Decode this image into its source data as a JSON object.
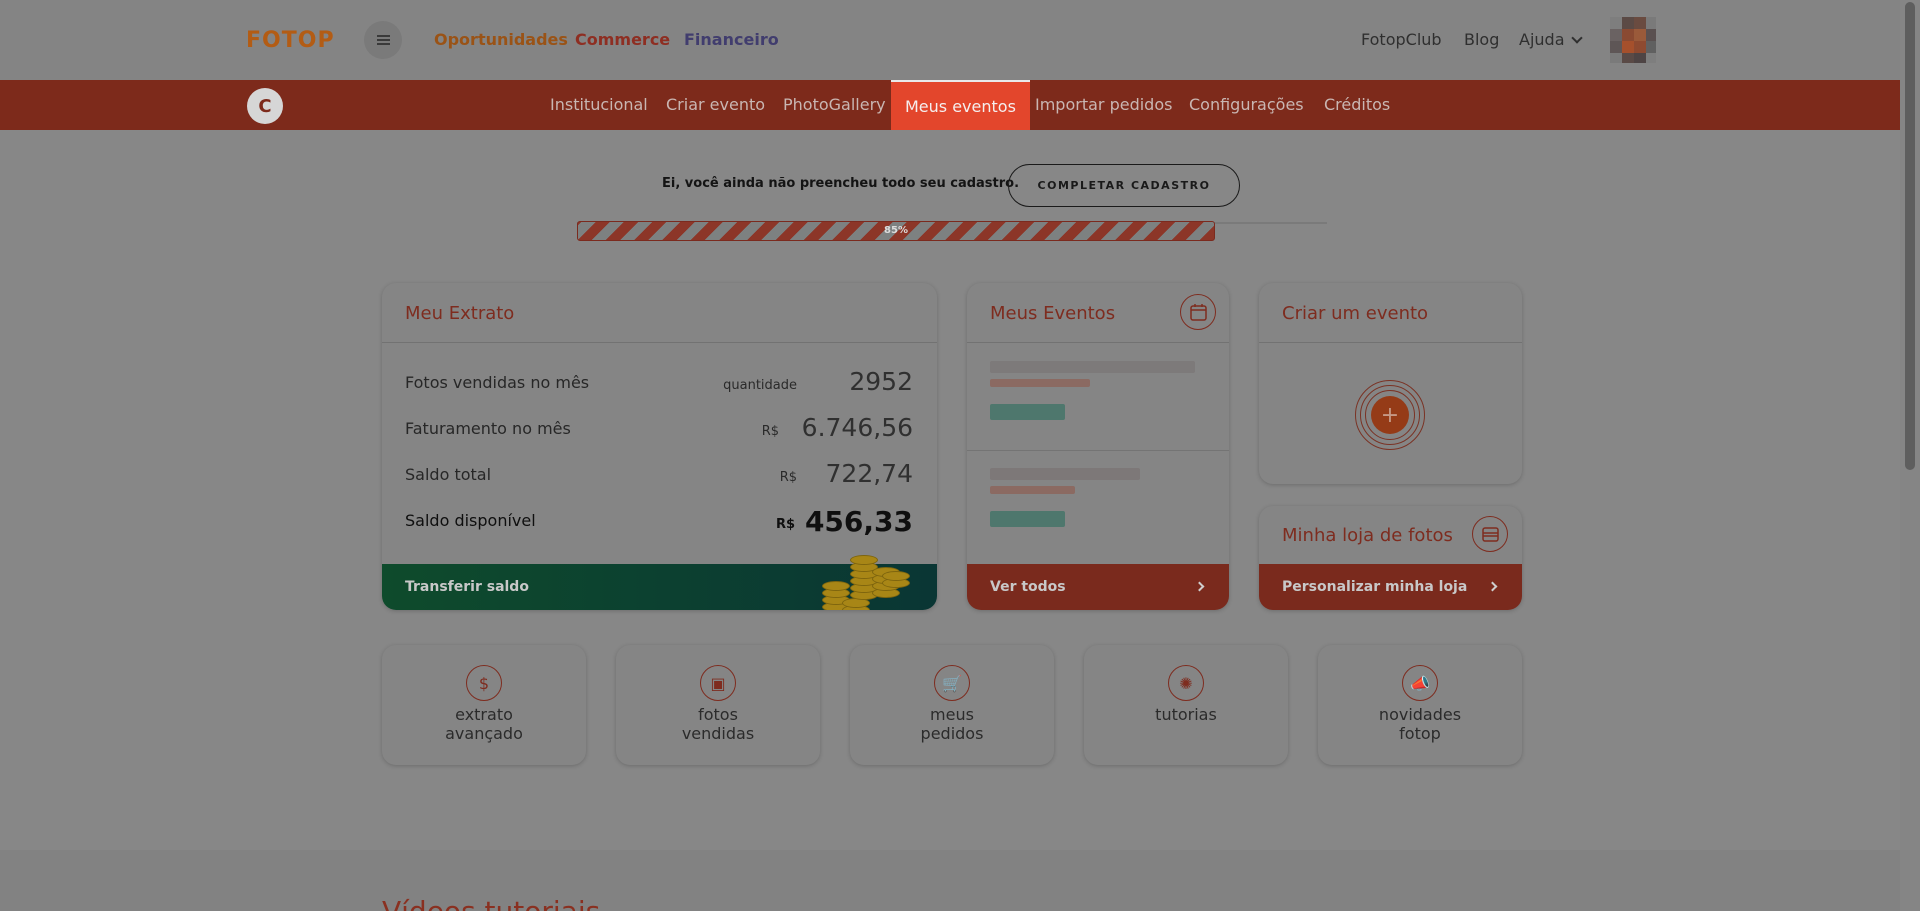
{
  "header": {
    "logo": "FOTOP",
    "links": [
      "Oportunidades",
      "Commerce",
      "Financeiro"
    ],
    "right_links": [
      "FotopClub",
      "Blog",
      "Ajuda"
    ]
  },
  "subnav": {
    "avatar_letter": "C",
    "items": [
      "Institucional",
      "Criar evento",
      "PhotoGallery",
      "Meus eventos",
      "Importar pedidos",
      "Configurações",
      "Créditos"
    ],
    "active": "Meus eventos"
  },
  "registration": {
    "message": "Ei, você ainda não preencheu todo seu cadastro.",
    "button": "COMPLETAR CADASTRO",
    "progress_label": "85%",
    "progress": 0.85
  },
  "extrato": {
    "title": "Meu Extrato",
    "rows": [
      {
        "label": "Fotos vendidas no mês",
        "unit": "quantidade",
        "value": "2952"
      },
      {
        "label": "Faturamento no mês",
        "unit": "R$",
        "value": "6.746,56"
      },
      {
        "label": "Saldo total",
        "unit": "R$",
        "value": "722,74"
      },
      {
        "label": "Saldo disponível",
        "unit": "R$",
        "value": "456,33"
      }
    ],
    "footer": "Transferir saldo"
  },
  "eventos": {
    "title": "Meus Eventos",
    "icon": "calendar-icon",
    "footer": "Ver todos"
  },
  "criar": {
    "title": "Criar um evento",
    "icon": "plus-icon"
  },
  "loja": {
    "title": "Minha loja de fotos",
    "icon": "store-icon",
    "footer": "Personalizar minha loja"
  },
  "tiles": [
    {
      "label": "extrato\navançado",
      "icon": "dollar-icon",
      "glyph": "$"
    },
    {
      "label": "fotos\nvendidas",
      "icon": "photo-icon",
      "glyph": "▣"
    },
    {
      "label": "meus\npedidos",
      "icon": "cart-icon",
      "glyph": "🛒"
    },
    {
      "label": "tutorias",
      "icon": "lightbulb-icon",
      "glyph": "✺"
    },
    {
      "label": "novidades\nfotop",
      "icon": "megaphone-icon",
      "glyph": "📣"
    }
  ],
  "videos": {
    "title": "Vídeos tutoriais"
  },
  "colors": {
    "accent": "#e3462c",
    "overlay": "#878787"
  }
}
